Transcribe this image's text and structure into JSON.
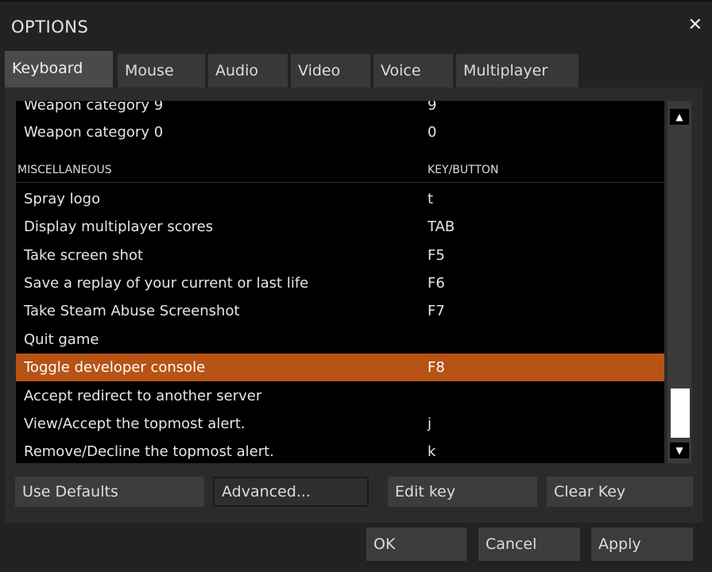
{
  "dialog": {
    "title": "OPTIONS",
    "close_icon": "close-icon"
  },
  "tabs": [
    {
      "label": "Keyboard"
    },
    {
      "label": "Mouse"
    },
    {
      "label": "Audio"
    },
    {
      "label": "Video"
    },
    {
      "label": "Voice"
    },
    {
      "label": "Multiplayer"
    }
  ],
  "keylist": {
    "rows": [
      {
        "action": "Weapon category 9",
        "key": "9"
      },
      {
        "action": "Weapon category 0",
        "key": "0"
      },
      {
        "action": "MISCELLANEOUS",
        "key": "KEY/BUTTON"
      },
      {
        "action": "Spray logo",
        "key": "t"
      },
      {
        "action": "Display multiplayer scores",
        "key": "TAB"
      },
      {
        "action": "Take screen shot",
        "key": "F5"
      },
      {
        "action": "Save a replay of your current or last life",
        "key": "F6"
      },
      {
        "action": "Take Steam Abuse Screenshot",
        "key": "F7"
      },
      {
        "action": "Quit game",
        "key": ""
      },
      {
        "action": "Toggle developer console",
        "key": "F8"
      },
      {
        "action": "Accept redirect to another server",
        "key": ""
      },
      {
        "action": "View/Accept the topmost alert.",
        "key": "j"
      },
      {
        "action": "Remove/Decline the topmost alert.",
        "key": "k"
      }
    ]
  },
  "buttons": {
    "use_defaults": "Use Defaults",
    "advanced": "Advanced...",
    "edit_key": "Edit key",
    "clear_key": "Clear Key",
    "ok": "OK",
    "cancel": "Cancel",
    "apply": "Apply"
  },
  "colors": {
    "selected_row": "#b65315"
  },
  "icons": {
    "scroll_up": "arrow-up-icon",
    "scroll_down": "arrow-down-icon"
  }
}
